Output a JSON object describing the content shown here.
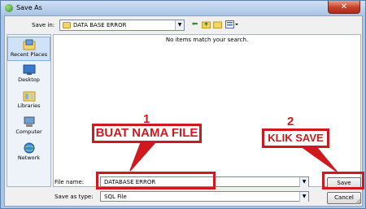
{
  "window": {
    "title": "Save As",
    "close_glyph": "✕"
  },
  "toolbar": {
    "save_in_label": "Save in:",
    "save_in_value": "DATA BASE ERROR",
    "icons": [
      "back-icon",
      "up-folder-icon",
      "new-folder-icon",
      "view-menu-icon"
    ]
  },
  "places": [
    {
      "label": "Recent Places",
      "icon": "recent-places-icon",
      "selected": true
    },
    {
      "label": "Desktop",
      "icon": "desktop-icon",
      "selected": false
    },
    {
      "label": "Libraries",
      "icon": "libraries-icon",
      "selected": false
    },
    {
      "label": "Computer",
      "icon": "computer-icon",
      "selected": false
    },
    {
      "label": "Network",
      "icon": "network-icon",
      "selected": false
    }
  ],
  "file_list": {
    "empty_message": "No items match your search."
  },
  "form": {
    "file_name_label": "File name:",
    "file_name_value": "DATABASE ERROR",
    "save_as_type_label": "Save as type:",
    "save_as_type_value": "SQL File"
  },
  "buttons": {
    "save": "Save",
    "cancel": "Cancel"
  },
  "annotations": {
    "step1_number": "1",
    "step1_text": "BUAT NAMA FILE",
    "step2_number": "2",
    "step2_text": "KLIK SAVE",
    "color": "#d0191f"
  }
}
